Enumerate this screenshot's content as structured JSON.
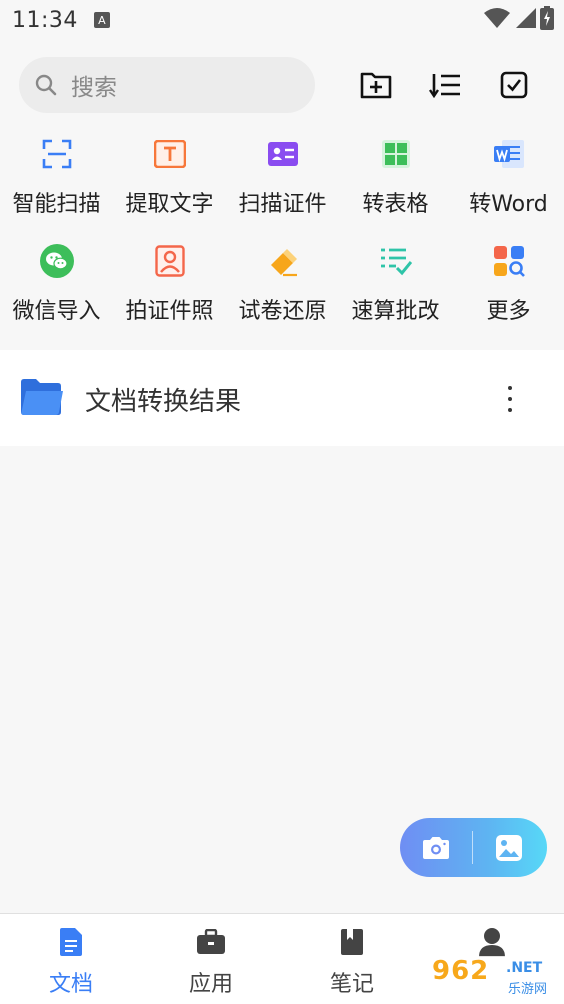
{
  "status_bar": {
    "time": "11:34",
    "notif_letter": "A"
  },
  "search": {
    "placeholder": "搜索"
  },
  "tools": [
    {
      "label": "智能扫描",
      "icon": "scan-frame-icon",
      "color": "#3a7ef5"
    },
    {
      "label": "提取文字",
      "icon": "text-extract-icon",
      "color": "#f7773a"
    },
    {
      "label": "扫描证件",
      "icon": "id-card-icon",
      "color": "#8a4cf0"
    },
    {
      "label": "转表格",
      "icon": "table-icon",
      "color": "#3dbe5a"
    },
    {
      "label": "转Word",
      "icon": "word-icon",
      "color": "#3a7ef5"
    },
    {
      "label": "微信导入",
      "icon": "wechat-icon",
      "color": "#3dbe5a"
    },
    {
      "label": "拍证件照",
      "icon": "portrait-icon",
      "color": "#f4664a"
    },
    {
      "label": "试卷还原",
      "icon": "eraser-icon",
      "color": "#f7a61b"
    },
    {
      "label": "速算批改",
      "icon": "checklist-icon",
      "color": "#2ec4a8"
    },
    {
      "label": "更多",
      "icon": "more-apps-icon",
      "color": "#f4664a"
    }
  ],
  "folder": {
    "title": "文档转换结果"
  },
  "nav": {
    "items": [
      {
        "label": "文档"
      },
      {
        "label": "应用"
      },
      {
        "label": "笔记"
      }
    ]
  },
  "watermark": {
    "number": "962",
    "net": ".NET",
    "sub": "乐游网"
  },
  "colors": {
    "accent": "#3a7ef5",
    "folder_blue": "#3b86f2"
  }
}
